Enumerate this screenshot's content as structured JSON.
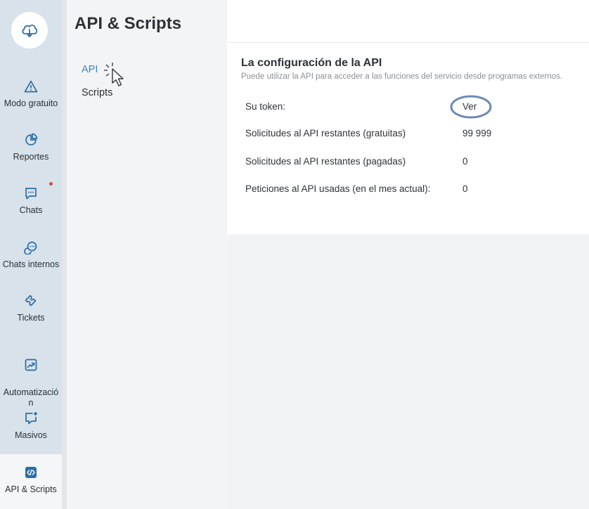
{
  "app": {
    "logo_icon": "cloud-icon"
  },
  "rail": [
    {
      "id": "free",
      "label": "Modo gratuito",
      "icon": "warning-icon"
    },
    {
      "id": "reports",
      "label": "Reportes",
      "icon": "pie-chart-icon"
    },
    {
      "id": "chats",
      "label": "Chats",
      "icon": "chat-icon",
      "notification": true
    },
    {
      "id": "internal",
      "label": "Chats internos",
      "icon": "chat-bubbles-icon"
    },
    {
      "id": "tickets",
      "label": "Tickets",
      "icon": "ticket-icon"
    },
    {
      "id": "automation",
      "label": "Automatizació\nn",
      "icon": "trend-chart-icon"
    },
    {
      "id": "bulk",
      "label": "Masivos",
      "icon": "chat-dot-icon"
    },
    {
      "id": "api",
      "label": "API & Scripts",
      "icon": "code-icon",
      "active": true
    }
  ],
  "page": {
    "title": "API & Scripts",
    "subnav": {
      "api_label": "API",
      "scripts_label": "Scripts"
    }
  },
  "card": {
    "title": "La configuración de la API",
    "description": "Puede utilizar la API para acceder a las funciones del servicio desde programas externos.",
    "token_label": "Su token:",
    "token_action": "Ver",
    "rows": [
      {
        "label": "Solicitudes al API restantes (gratuitas)",
        "value": "99 999"
      },
      {
        "label": "Solicitudes al API restantes (pagadas)",
        "value": "0"
      },
      {
        "label": "Peticiones al API usadas (en el mes actual):",
        "value": "0"
      }
    ]
  },
  "colors": {
    "accent": "#3a86c8",
    "rail_bg": "#d8e2ea",
    "icon": "#2c6ea6",
    "annotation": "#6b8ab5",
    "notification": "#e0483e"
  }
}
